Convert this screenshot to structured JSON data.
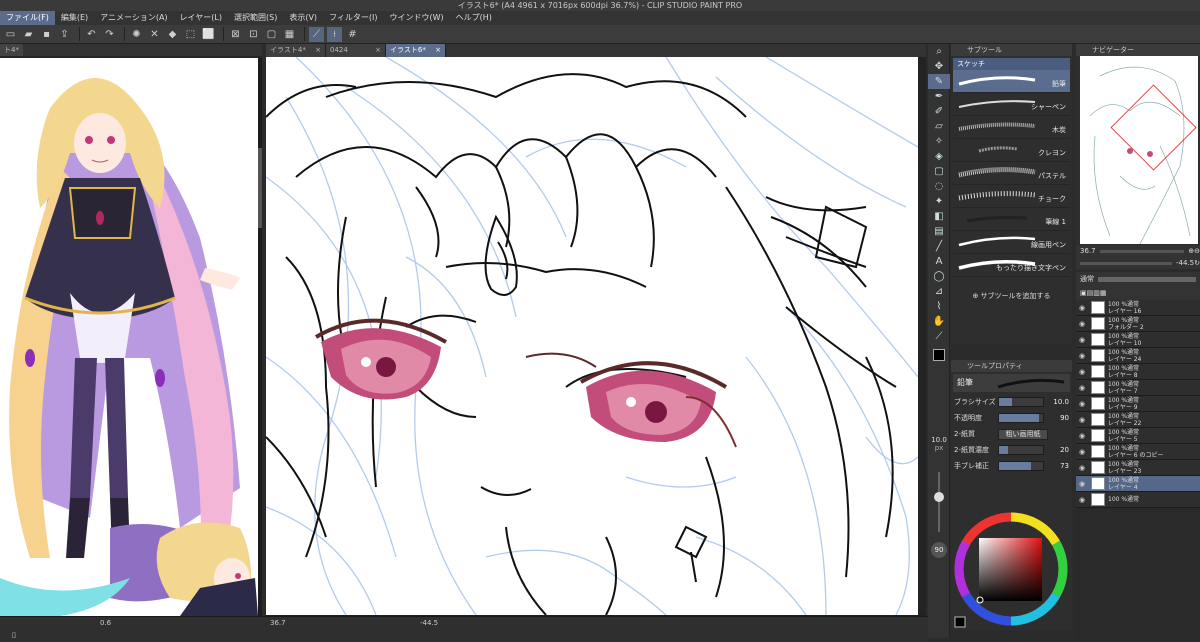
{
  "window": {
    "title": "イラスト6* (A4 4961 x 7016px 600dpi 36.7%) - CLIP STUDIO PAINT PRO"
  },
  "menu": [
    "ファイル(F)",
    "編集(E)",
    "アニメーション(A)",
    "レイヤー(L)",
    "選択範囲(S)",
    "表示(V)",
    "フィルター(I)",
    "ウインドウ(W)",
    "ヘルプ(H)"
  ],
  "left_tab": "ト4*",
  "doc_tabs": [
    {
      "label": "イラスト4*"
    },
    {
      "label": "0424"
    },
    {
      "label": "イラスト6*"
    }
  ],
  "subtool": {
    "header": "サブツール",
    "group": "スケッチ",
    "brushes": [
      "鉛筆",
      "シャーペン",
      "木炭",
      "クレヨン",
      "パステル",
      "チョーク",
      "筆線 1",
      "線画用ペン",
      "もったり描き文字ペン"
    ],
    "add_label": "サブツールを追加する"
  },
  "tool_property": {
    "header": "ツールプロパティ",
    "brush_name": "鉛筆",
    "rows": [
      {
        "name": "ブラシサイズ",
        "value": "10.0",
        "fill": 0.3
      },
      {
        "name": "不透明度",
        "value": "90",
        "fill": 0.9
      },
      {
        "name": "紙質濃度",
        "value": "20",
        "fill": 0.2
      },
      {
        "name": "手ブレ補正",
        "value": "73",
        "fill": 0.73
      }
    ],
    "paper_label": "2-紙質",
    "paper_value": "粗い画用紙",
    "density_label": "2-紙質濃度"
  },
  "brush_size": {
    "value": "10.0",
    "unit": "px"
  },
  "color_value": "90",
  "navigator": {
    "header": "ナビゲーター",
    "zoom": "36.7",
    "angle": "-44.5"
  },
  "layers": {
    "blend": "通常",
    "items": [
      {
        "opacity": "100 %通常",
        "name": "レイヤー 16"
      },
      {
        "opacity": "100 %通常",
        "name": "フォルダー 2"
      },
      {
        "opacity": "100 %通常",
        "name": "レイヤー 10"
      },
      {
        "opacity": "100 %通常",
        "name": "レイヤー 24"
      },
      {
        "opacity": "100 %通常",
        "name": "レイヤー 8"
      },
      {
        "opacity": "100 %通常",
        "name": "レイヤー 7"
      },
      {
        "opacity": "100 %通常",
        "name": "レイヤー 9"
      },
      {
        "opacity": "100 %通常",
        "name": "レイヤー 22"
      },
      {
        "opacity": "100 %通常",
        "name": "レイヤー 5"
      },
      {
        "opacity": "100 %通常",
        "name": "レイヤー 6 のコピー"
      },
      {
        "opacity": "100 %通常",
        "name": "レイヤー 23"
      },
      {
        "opacity": "100 %通常",
        "name": "レイヤー 4"
      },
      {
        "opacity": "100 %通常",
        "name": ""
      }
    ]
  },
  "status": {
    "left_zoom": "0.6",
    "main_zoom": "36.7",
    "main_angle": "-44.5"
  },
  "colors": {
    "accent": "#5a6b8c",
    "sketch_blue": "#aac6ea"
  }
}
